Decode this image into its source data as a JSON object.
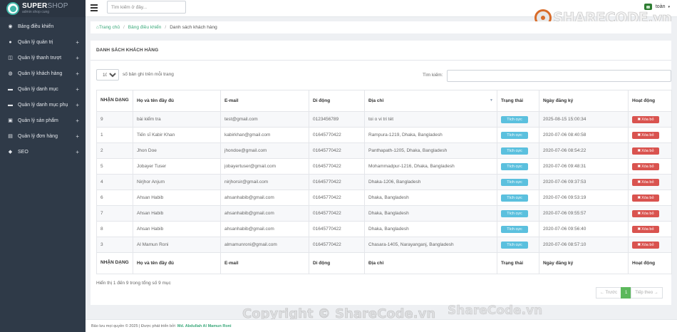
{
  "brand": {
    "title_bold": "SUPER",
    "title_light": "SHOP",
    "subtitle": "admin shop cung"
  },
  "sidebar": {
    "items": [
      {
        "label": "Bảng điều khiển",
        "icon": "dashboard-icon",
        "expandable": false
      },
      {
        "label": "Quản lý quản trị",
        "icon": "user-icon",
        "expandable": true
      },
      {
        "label": "Quản lý thanh trượt",
        "icon": "slider-icon",
        "expandable": true
      },
      {
        "label": "Quản lý khách hàng",
        "icon": "users-icon",
        "expandable": true
      },
      {
        "label": "Quản lý danh mục",
        "icon": "folder-icon",
        "expandable": true
      },
      {
        "label": "Quản lý danh mục phụ",
        "icon": "folder-icon",
        "expandable": true
      },
      {
        "label": "Quản lý sản phẩm",
        "icon": "box-icon",
        "expandable": true
      },
      {
        "label": "Quản lý đơn hàng",
        "icon": "cart-icon",
        "expandable": true
      },
      {
        "label": "SEO",
        "icon": "tag-icon",
        "expandable": true
      }
    ],
    "plus": "+"
  },
  "topbar": {
    "search_placeholder": "Tìm kiếm ở đây...",
    "user_name": "toàn",
    "caret": "▾"
  },
  "breadcrumb": {
    "home": "Trang chủ",
    "dashboard": "Bảng điều khiển",
    "current": "Danh sách khách hàng",
    "sep": "/"
  },
  "panel": {
    "title": "DANH SÁCH KHÁCH HÀNG",
    "length_value": "10",
    "length_label": "số bản ghi trên mỗi trang",
    "search_label": "Tìm kiếm:",
    "info": "Hiển thị 1 đến 9 trong tổng số 9 mục"
  },
  "table": {
    "headers": [
      "NHẬN DẠNG",
      "Họ và tên đầy đủ",
      "E-mail",
      "Di động",
      "Địa chỉ",
      "Trạng thái",
      "Ngày đăng ký",
      "Hoạt động"
    ],
    "sort_icon": "▼",
    "rows": [
      [
        "9",
        "bài kiểm tra",
        "test@gmail.com",
        "0123456789",
        "toi o vi tri tét",
        "Tích cực",
        "2025-08-15 15:00:34",
        "Xóa bỏ"
      ],
      [
        "1",
        "Tiến sĩ Kabir Khan",
        "kabirkhan@gmail.com",
        "01645770422",
        "Rampura-1219, Dhaka, Bangladesh",
        "Tích cực",
        "2020-07-06 08:40:58",
        "Xóa bỏ"
      ],
      [
        "2",
        "Jhon Doe",
        "jhondoe@gmail.com",
        "01645770422",
        "Panthapath-1205, Dhaka, Bangladesh",
        "Tích cực",
        "2020-07-06 08:54:22",
        "Xóa bỏ"
      ],
      [
        "5",
        "Jobayer Tuser",
        "jobayertuser@gmail.com",
        "01645770422",
        "Mohammadpur-1216, Dhaka, Bangladesh",
        "Tích cực",
        "2020-07-06 09:48:31",
        "Xóa bỏ"
      ],
      [
        "4",
        "Nirjhor Anjum",
        "nirjhorsir@gmail.com",
        "01645770422",
        "Dhaka-1206, Bangladesh",
        "Tích cực",
        "2020-07-06 09:37:53",
        "Xóa bỏ"
      ],
      [
        "6",
        "Ahsan Habib",
        "ahsanhabib@gmail.com",
        "01645770422",
        "Dhaka, Bangladesh",
        "Tích cực",
        "2020-07-06 09:53:19",
        "Xóa bỏ"
      ],
      [
        "7",
        "Ahsan Habib",
        "ahsanhabib@gmail.com",
        "01645770422",
        "Dhaka, Bangladesh",
        "Tích cực",
        "2020-07-06 09:55:57",
        "Xóa bỏ"
      ],
      [
        "8",
        "Ahsan Habib",
        "ahsanhabib@gmail.com",
        "01645770422",
        "Dhaka, Bangladesh",
        "Tích cực",
        "2020-07-06 09:56:40",
        "Xóa bỏ"
      ],
      [
        "3",
        "Al Mamun Roni",
        "almamunroni@gmail.com",
        "01645770422",
        "Chasara-1405, Narayanganj, Bangladesh",
        "Tích cực",
        "2020-07-06 08:57:10",
        "Xóa bỏ"
      ]
    ]
  },
  "pager": {
    "prev": "← Trước",
    "page": "1",
    "next": "Tiếp theo →"
  },
  "footer": {
    "text": "Bảo lưu mọi quyền © 2025 | Được phát triển bởi",
    "author": "Md. Abdullah Al Mamun Roni"
  },
  "watermark": {
    "logo": "SHARECODE.vn",
    "copyright": "Copyright © ShareCode.vn",
    "small": "ShareCode.vn"
  },
  "colors": {
    "sidebar": "#2f3a48",
    "accent": "#3aa87a",
    "badge": "#5bc0de",
    "danger": "#d9534f",
    "pager_active": "#5cb85c"
  }
}
